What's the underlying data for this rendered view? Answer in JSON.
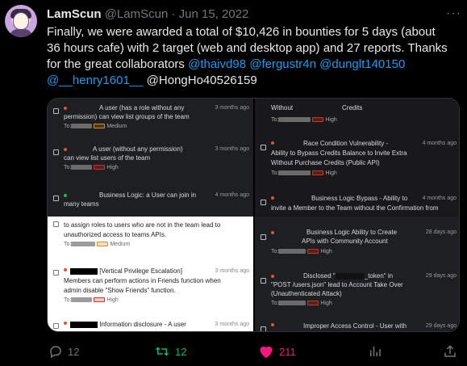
{
  "tweet": {
    "display_name": "LamScun",
    "handle": "@LamScun",
    "separator": "·",
    "date": "Jun 15, 2022",
    "more_label": "···",
    "text_line1": "Finally, we were awarded a total of $10,426 in bounties for 5 days (about",
    "text_line2": "36 hours cafe) with 2 target (web and desktop app) and 27 reports. Thanks",
    "text_line3_prefix": "for the great collaborators ",
    "mentions": [
      "@thaivd98",
      "@fergustr4n",
      "@dunglt140150",
      "@__henry1601__",
      "@HongHo40526159"
    ]
  },
  "media": {
    "panel_tl": [
      {
        "title_l1": "A user (has a role without any",
        "title_l2": "permission) can view list groups of the team",
        "date": "3 months ago",
        "to": "To:",
        "severity": "Medium",
        "dot": "#e6522c"
      },
      {
        "title_l1": "A user (without any permission)",
        "title_l2": "can view list users of the team",
        "date": "3 months ago",
        "to": "To:",
        "severity": "High",
        "dot": "#e6522c"
      },
      {
        "title_l1": "Business Logic: a User can join in",
        "title_l2": "many teams",
        "date": "4 months ago",
        "to": "To:",
        "severity": "",
        "dot": "#2fb344"
      }
    ],
    "panel_tr": [
      {
        "title_l1": "Without",
        "title_l2": "Credits",
        "date": "",
        "to": "To:",
        "severity": "High",
        "dot": ""
      },
      {
        "title_l1": "Race Condition Vulnerability -",
        "title_l2": "Ability to Bypass        Credits Balance to Invite Extra",
        "title_l3": "Without Purchase           Credits (Public API)",
        "date": "4 months ago",
        "to": "To:",
        "severity": "High",
        "dot": "#e6522c"
      },
      {
        "title_l1": "Business Logic Bypass - Ability to",
        "title_l2": "invite a Member to the Team without the Confirmation from",
        "date": "4 months ago",
        "to": "",
        "severity": "",
        "dot": "#e6522c"
      }
    ],
    "panel_bl": [
      {
        "title_l1": "to assign roles to users who are not in the team lead to",
        "title_l2": "unauthorized access to teams APIs.",
        "date": "",
        "to": "To:",
        "severity": "Medium",
        "dot": ""
      },
      {
        "title_l1": "[Vertical Privilege Escalation]",
        "title_l2": "Members can perform actions in Friends function when",
        "title_l3": "admin disable \"Show Friends\" function.",
        "date": "3 months ago",
        "to": "To:",
        "severity": "High",
        "dot": "#e6522c"
      },
      {
        "title_l1": "Information disclosure - A user",
        "title_l2": "",
        "date": "3 months ago",
        "to": "",
        "severity": "",
        "dot": "#e6522c"
      }
    ],
    "panel_br": [
      {
        "title_l1": "Business Logic Ability to Create",
        "title_l2": "APIs with Community Account",
        "date": "28 days ago",
        "to": "To:",
        "severity": "High",
        "dot": "#e6522c"
      },
      {
        "title_l1": "Disclosed \"",
        "title_l1b": "_token\" in",
        "title_l2": "\"POST /users.json\" lead to Account Take Over",
        "title_l3": "(Unauthenticated Attack)",
        "date": "29 days ago",
        "to": "To:",
        "severity": "High",
        "dot": "#e6522c"
      },
      {
        "title_l1": "Improper Access Control - User with",
        "title_l2": "",
        "date": "29 days ago",
        "to": "",
        "severity": "",
        "dot": "#e6522c"
      }
    ]
  },
  "actions": {
    "replies": "12",
    "retweets": "12",
    "likes": "211"
  },
  "colors": {
    "background": "#000000",
    "text": "#e7e9ea",
    "secondary": "#71767b",
    "link": "#1d9bf0",
    "like": "#f91880",
    "retweet": "#00ba7c"
  }
}
